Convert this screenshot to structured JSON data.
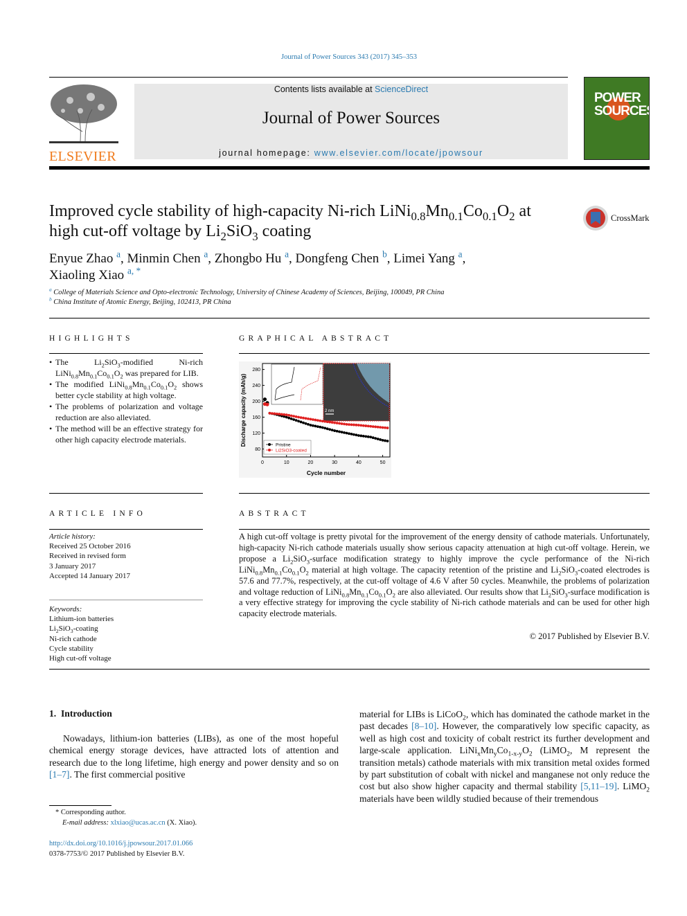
{
  "header": {
    "citation": "Journal of Power Sources 343 (2017) 345–353",
    "contents_prefix": "Contents lists available at ",
    "sciencedirect": "ScienceDirect",
    "journal_title": "Journal of Power Sources",
    "homepage_prefix": "journal homepage: ",
    "homepage_url": "www.elsevier.com/locate/jpowsour",
    "publisher_logo": "ELSEVIER",
    "cover_text": "POWER SOURCES"
  },
  "article": {
    "title_line1": "Improved cycle stability of high-capacity Ni-rich LiNi_{0.8}Mn_{0.1}Co_{0.1}O_{2} at",
    "title_line2": "high cut-off voltage by Li_{2}SiO_{3} coating",
    "crossmark": "CrossMark",
    "authors_line1": "Enyue Zhao ^{a}, Minmin Chen ^{a}, Zhongbo Hu ^{a}, Dongfeng Chen ^{b}, Limei Yang ^{a},",
    "authors_line2": "Xiaoling Xiao ^{a, *}",
    "affiliation_a": "^{a} College of Materials Science and Opto-electronic Technology, University of Chinese Academy of Sciences, Beijing, 100049, PR China",
    "affiliation_b": "^{b} China Institute of Atomic Energy, Beijing, 102413, PR China"
  },
  "highlights": {
    "heading": "HIGHLIGHTS",
    "items": [
      "The Li_{2}SiO_{3}-modified Ni-rich LiNi_{0.8}Mn_{0.1}Co_{0.1}O_{2} was prepared for LIB.",
      "The modified LiNi_{0.8}Mn_{0.1}Co_{0.1}O_{2} shows better cycle stability at high voltage.",
      "The problems of polarization and voltage reduction are also alleviated.",
      "The method will be an effective strategy for other high capacity electrode materials."
    ]
  },
  "graphical_abstract": {
    "heading": "GRAPHICAL ABSTRACT"
  },
  "chart_data": {
    "type": "scatter",
    "xlabel": "Cycle number",
    "ylabel": "Discharge capacity (mAh/g)",
    "xlim": [
      0,
      53
    ],
    "ylim": [
      60,
      295
    ],
    "xticks": [
      0,
      10,
      20,
      30,
      40,
      50
    ],
    "yticks": [
      80,
      120,
      160,
      200,
      240,
      280
    ],
    "legend": "bottom-left",
    "inset_scale_label": "2 nm",
    "series": [
      {
        "name": "Pristine",
        "color": "#000000",
        "x": [
          1,
          2,
          3,
          5,
          10,
          15,
          20,
          25,
          30,
          35,
          40,
          45,
          50,
          52
        ],
        "y": [
          205,
          196,
          170,
          168,
          160,
          150,
          140,
          134,
          126,
          120,
          114,
          110,
          102,
          100
        ]
      },
      {
        "name": "Li_{2}SiO_{3}-coated",
        "color": "#e02020",
        "x": [
          1,
          2,
          3,
          5,
          10,
          15,
          20,
          25,
          30,
          35,
          40,
          45,
          50,
          52
        ],
        "y": [
          193,
          192,
          170,
          169,
          166,
          160,
          155,
          150,
          146,
          142,
          140,
          137,
          134,
          133
        ]
      }
    ]
  },
  "article_info": {
    "heading": "ARTICLE INFO",
    "history_label": "Article history:",
    "history": [
      "Received 25 October 2016",
      "Received in revised form",
      "3 January 2017",
      "Accepted 14 January 2017"
    ],
    "keywords_label": "Keywords:",
    "keywords": [
      "Lithium-ion batteries",
      "Li_{2}SiO_{3}-coating",
      "Ni-rich cathode",
      "Cycle stability",
      "High cut-off voltage"
    ]
  },
  "abstract": {
    "heading": "ABSTRACT",
    "text": "A high cut-off voltage is pretty pivotal for the improvement of the energy density of cathode materials. Unfortunately, high-capacity Ni-rich cathode materials usually show serious capacity attenuation at high cut-off voltage. Herein, we propose a Li_{2}SiO_{3}-surface modification strategy to highly improve the cycle performance of the Ni-rich LiNi_{0.8}Mn_{0.1}Co_{0.1}O_{2} material at high voltage. The capacity retention of the pristine and Li_{2}SiO_{3}-coated electrodes is 57.6 and 77.7%, respectively, at the cut-off voltage of 4.6 V after 50 cycles. Meanwhile, the problems of polarization and voltage reduction of LiNi_{0.8}Mn_{0.1}Co_{0.1}O_{2} are also alleviated. Our results show that Li_{2}SiO_{3}-surface modification is a very effective strategy for improving the cycle stability of Ni-rich cathode materials and can be used for other high capacity electrode materials.",
    "copyright": "© 2017 Published by Elsevier B.V."
  },
  "intro": {
    "heading": "1.  Introduction",
    "p1_a": "Nowadays, lithium-ion batteries (LIBs), as one of the most hopeful chemical energy storage devices, have attracted lots of attention and research due to the long lifetime, high energy and power density and so on ",
    "p1_ref": "[1–7]",
    "p1_b": ". The first commercial positive",
    "c2_a": "material for LIBs is LiCoO_{2}, which has dominated the cathode market in the past decades ",
    "c2_ref1": "[8–10]",
    "c2_b": ". However, the comparatively low specific capacity, as well as high cost and toxicity of cobalt restrict its further development and large-scale application. LiNi_{x}Mn_{y}Co_{1-x-y}O_{2} (LiMO_{2}, M represent the transition metals) cathode materials with mix transition metal oxides formed by part substitution of cobalt with nickel and manganese not only reduce the cost but also show higher capacity and thermal stability ",
    "c2_ref2": "[5,11–19]",
    "c2_c": ". LiMO_{2} materials have been wildly studied because of their tremendous"
  },
  "footnote": {
    "corresponding": "* Corresponding author.",
    "email_label": "E-mail address: ",
    "email": "xlxiao@ucas.ac.cn",
    "email_suffix": " (X. Xiao).",
    "doi": "http://dx.doi.org/10.1016/j.jpowsour.2017.01.066",
    "issn": "0378-7753/© 2017 Published by Elsevier B.V."
  }
}
